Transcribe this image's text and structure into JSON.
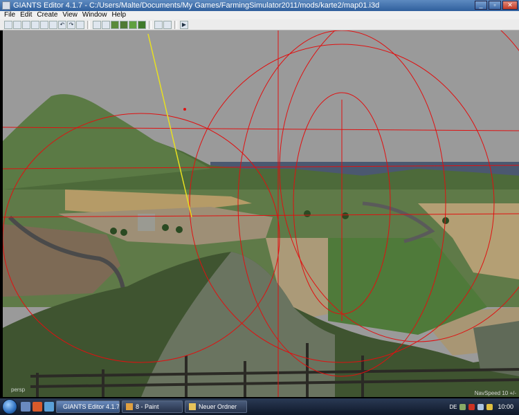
{
  "window": {
    "title": "GIANTS Editor 4.1.7 - C:/Users/Malte/Documents/My Games/FarmingSimulator2011/mods/karte2/map01.i3d",
    "controls": [
      "minimize",
      "maximize",
      "close"
    ]
  },
  "menu": {
    "items": [
      {
        "label": "File"
      },
      {
        "label": "Edit"
      },
      {
        "label": "Create"
      },
      {
        "label": "View"
      },
      {
        "label": "Window"
      },
      {
        "label": "Help"
      }
    ]
  },
  "toolbar": {
    "groups": [
      [
        "new-file-icon",
        "open-file-icon",
        "save-icon",
        "save-as-icon",
        "export-icon",
        "import-icon",
        "undo-icon",
        "redo-icon",
        "refresh-icon"
      ],
      [
        "select-icon",
        "move-icon",
        "terrain-paint-icon",
        "terrain-sculpt-icon",
        "foliage-icon",
        "tree-icon"
      ],
      [
        "snap-icon",
        "camera-icon"
      ],
      [
        "play-icon"
      ]
    ]
  },
  "viewport": {
    "camera_label": "persp",
    "navspeed": "NavSpeed 10 +/-"
  },
  "taskbar": {
    "tasks": [
      {
        "label": "GIANTS Editor 4.1.7 ...",
        "icon": "giants-editor-icon",
        "active": true
      },
      {
        "label": "8 - Paint",
        "icon": "paint-icon",
        "active": false
      },
      {
        "label": "Neuer Ordner",
        "icon": "folder-icon",
        "active": false
      }
    ],
    "language": "DE",
    "clock": "10:00"
  },
  "colors": {
    "sky": "#999999",
    "gizmo_red": "#e01010",
    "gizmo_yellow": "#e8e020"
  }
}
